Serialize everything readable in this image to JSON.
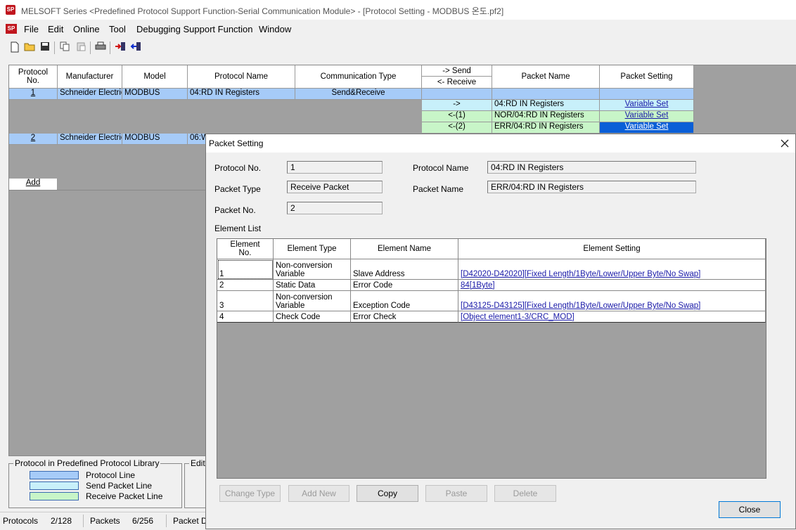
{
  "window": {
    "title": "MELSOFT Series <Predefined Protocol Support Function-Serial Communication Module> - [Protocol Setting - MODBUS 온도.pf2]",
    "app_icon": "melsoft-icon"
  },
  "menu": [
    "File",
    "Edit",
    "Online",
    "Tool",
    "Debugging Support Function",
    "Window"
  ],
  "toolbar": [
    "new-file-icon",
    "open-folder-icon",
    "save-icon",
    "copy-icon",
    "paste-icon",
    "print-icon",
    "write-to-module-icon",
    "read-from-module-icon"
  ],
  "grid": {
    "headers": {
      "protocol_no": "Protocol\nNo.",
      "manufacturer": "Manufacturer",
      "model": "Model",
      "protocol_name": "Protocol Name",
      "comm_type": "Communication Type",
      "send": "-> Send",
      "receive": "<- Receive",
      "packet_name": "Packet Name",
      "packet_setting": "Packet Setting"
    },
    "protocols": [
      {
        "no": "1",
        "manufacturer": "Schneider Electric",
        "model": "MODBUS",
        "name": "04:RD IN Registers",
        "comm_type": "Send&Receive"
      },
      {
        "no": "2",
        "manufacturer": "Schneider Electric",
        "model": "MODBUS",
        "name": "06:W",
        "comm_type": ""
      }
    ],
    "packets": [
      {
        "dir": "->",
        "name": "04:RD IN Registers",
        "setting": "Variable Set"
      },
      {
        "dir": "<-(1)",
        "name": "NOR/04:RD IN Registers",
        "setting": "Variable Set"
      },
      {
        "dir": "<-(2)",
        "name": "ERR/04:RD IN Registers",
        "setting": "Variable Set"
      }
    ],
    "add_label": "Add"
  },
  "legend": {
    "title": "Protocol in Predefined Protocol Library",
    "items": [
      {
        "label": "Protocol Line",
        "color": "#a6cbf8"
      },
      {
        "label": "Send Packet Line",
        "color": "#c8f0fa"
      },
      {
        "label": "Receive Packet Line",
        "color": "#c8f5c8"
      }
    ],
    "edit_title": "Edit"
  },
  "status": {
    "protocols_label": "Protocols",
    "protocols_value": "2/128",
    "packets_label": "Packets",
    "packets_value": "6/256",
    "packet_d_label": "Packet D"
  },
  "dialog": {
    "title": "Packet Setting",
    "protocol_no_label": "Protocol No.",
    "protocol_no": "1",
    "protocol_name_label": "Protocol Name",
    "protocol_name": "04:RD IN Registers",
    "packet_type_label": "Packet Type",
    "packet_type": "Receive Packet",
    "packet_name_label": "Packet Name",
    "packet_name": "ERR/04:RD IN Registers",
    "packet_no_label": "Packet No.",
    "packet_no": "2",
    "element_list_label": "Element List",
    "columns": {
      "no": "Element\nNo.",
      "type": "Element Type",
      "name": "Element Name",
      "setting": "Element Setting"
    },
    "elements": [
      {
        "no": "1",
        "type": "Non-conversion\nVariable",
        "name": "Slave Address",
        "setting": "[D42020-D42020][Fixed Length/1Byte/Lower/Upper Byte/No Swap]"
      },
      {
        "no": "2",
        "type": "Static Data",
        "name": "Error Code",
        "setting": "84[1Byte]"
      },
      {
        "no": "3",
        "type": "Non-conversion\nVariable",
        "name": "Exception Code",
        "setting": "[D43125-D43125][Fixed Length/1Byte/Lower/Upper Byte/No Swap]"
      },
      {
        "no": "4",
        "type": "Check Code",
        "name": "Error Check",
        "setting": "[Object element1-3/CRC_MOD]"
      }
    ],
    "buttons": {
      "change_type": "Change Type",
      "add_new": "Add New",
      "copy": "Copy",
      "paste": "Paste",
      "delete": "Delete",
      "close": "Close"
    }
  }
}
